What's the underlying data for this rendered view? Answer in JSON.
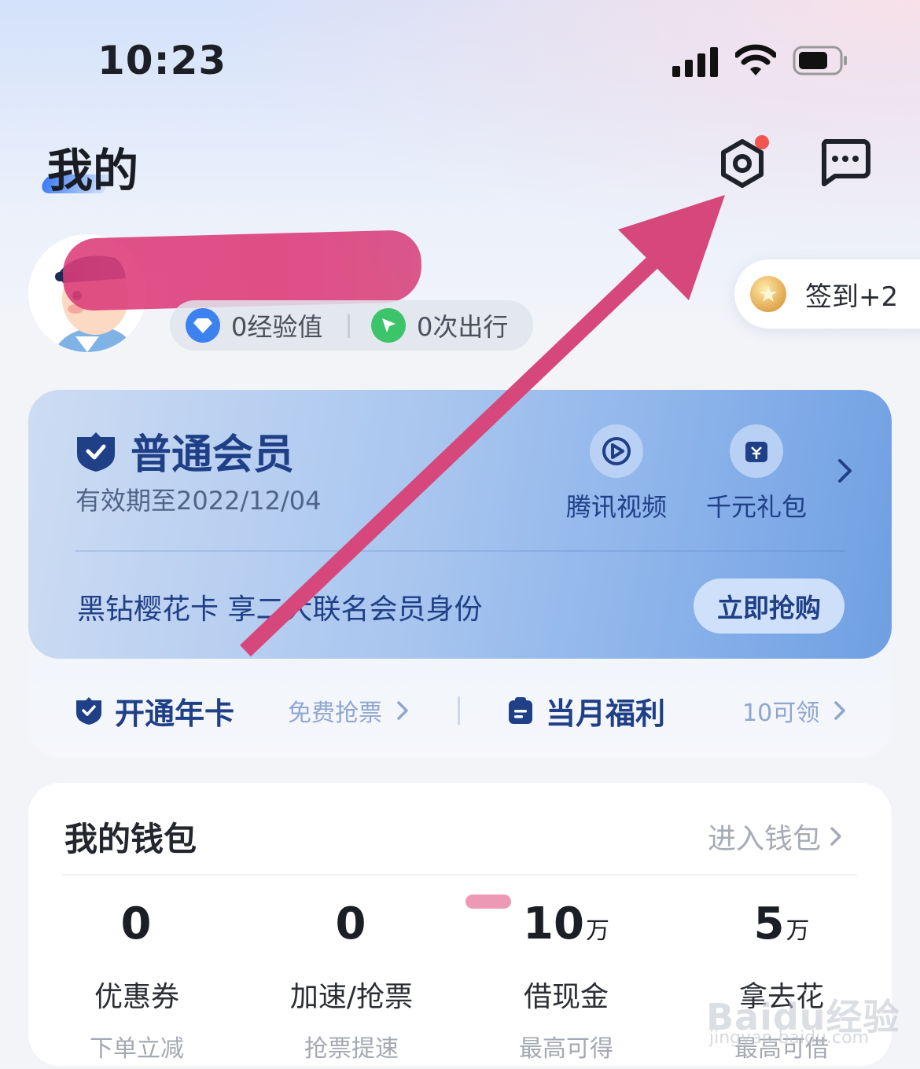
{
  "status_bar": {
    "time": "10:23"
  },
  "header": {
    "title": "我的"
  },
  "profile": {
    "experience": "0经验值",
    "trips": "0次出行",
    "checkin": "签到+2"
  },
  "member": {
    "level": "普通会员",
    "expiry": "有效期至2022/12/04",
    "benefits": [
      {
        "label": "腾讯视频",
        "icon": "tencent-video-icon"
      },
      {
        "label": "千元礼包",
        "icon": "gift-pack-icon"
      }
    ],
    "promo": "黑钻樱花卡 享二大联名会员身份",
    "buy_button": "立即抢购",
    "annual_card": {
      "label": "开通年卡",
      "link": "免费抢票"
    },
    "monthly": {
      "label": "当月福利",
      "link": "10可领"
    }
  },
  "wallet": {
    "title": "我的钱包",
    "enter_link": "进入钱包",
    "items": [
      {
        "value": "0",
        "unit": "",
        "label": "优惠券",
        "sub": "下单立减"
      },
      {
        "value": "0",
        "unit": "",
        "label": "加速/抢票",
        "sub": "抢票提速"
      },
      {
        "value": "10",
        "unit": "万",
        "label": "借现金",
        "sub": "最高可得"
      },
      {
        "value": "5",
        "unit": "万",
        "label": "拿去花",
        "sub": "最高可借"
      }
    ]
  },
  "watermark": {
    "brand": "Baidu经验",
    "url": "jingyan.baidu.com"
  },
  "colors": {
    "accent": "#1f3f87",
    "annotation_arrow": "#d6487b",
    "notification_dot": "#f3544f"
  }
}
